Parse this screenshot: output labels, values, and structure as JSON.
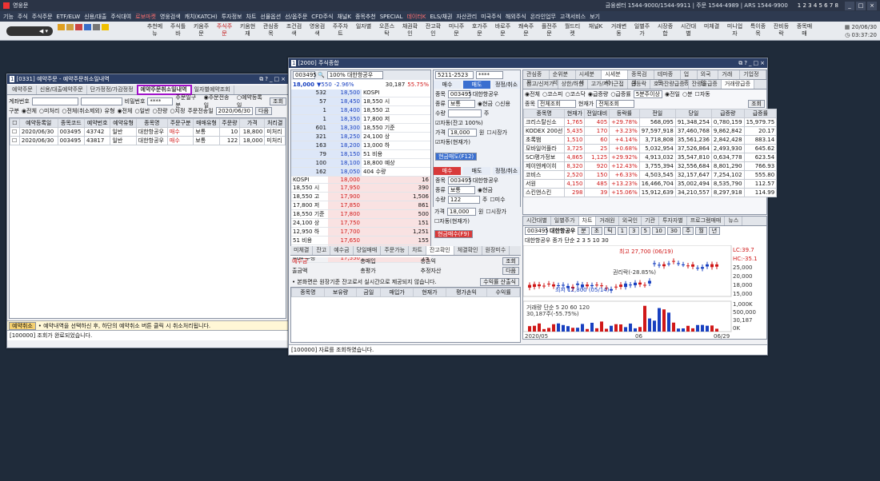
{
  "app": {
    "name": "영웅문",
    "center": "금융센터 1544-9000/1544-9911 | 주문 1544-4989 | ARS 1544-9900",
    "title_numbers": "1 2 3 4 5 6 7 8"
  },
  "menu": [
    "기능",
    "주식",
    "주식주문",
    "ETF/ELW",
    "신용/대출",
    "주식대여",
    "로보마켓",
    "영웅검색",
    "캐치(KATCH)",
    "투자정보",
    "차트",
    "선물옵션",
    "선/옵주문",
    "CFD주식",
    "채널K",
    "종목추천",
    "SPECIAL",
    "데이터K",
    "ELS/채권",
    "자산관리",
    "미국주식",
    "해외주식",
    "온라인업무",
    "고객서비스",
    "보기"
  ],
  "toolbar": {
    "items": [
      "추천메뉴",
      "주식틀바",
      "키움주문",
      "주식주문",
      "키움현재",
      "관심종목",
      "조건검색",
      "영웅검색",
      "주주차트",
      "일자별",
      "오픈스탁",
      "채권확인",
      "잔고확인",
      "미니주문",
      "호가주문",
      "바로주문",
      "쾌속주문",
      "플전주문",
      "월드티켓",
      "채널K",
      "거래변동",
      "일별주가",
      "시장종합",
      "시간대별",
      "미체결",
      "미니업자",
      "특이종목",
      "잔비등락",
      "종목매매"
    ],
    "date": "20/06/30",
    "time": "03:37:20"
  },
  "win1": {
    "title": "[0331] 예약주문 - 예약주문취소일내역",
    "tabs": [
      "예약주문",
      "신용/대출예약주문",
      "단가정정/가감정정",
      "예약주문취소일내역",
      "일자별예약조회"
    ],
    "account_label": "계좌번호",
    "password_label": "비밀번호",
    "password": "****",
    "order_kind_label": "주문일구분",
    "opt1": "주문전송일",
    "opt2": "예약등록일",
    "query": "조회",
    "filter_label": "구분",
    "f1": "전체",
    "f2": "미처리",
    "f3": "전체(취소제외)",
    "type_label": "유형",
    "t1": "전체",
    "t2": "일반",
    "t3": "잔량",
    "t4": "지정",
    "send_label": "주문전송일",
    "send_date": "2020/06/30",
    "next": "다음",
    "cols": [
      "예약등록일",
      "종목코드",
      "예약번호",
      "예약유형",
      "종목명",
      "주문구분",
      "매매유형",
      "주문량",
      "가격",
      "처리결"
    ],
    "rows": [
      [
        "2020/06/30",
        "003495",
        "43742",
        "일반",
        "대한항공우",
        "매수",
        "보통",
        "10",
        "18,800",
        "미처리"
      ],
      [
        "2020/06/30",
        "003495",
        "43817",
        "일반",
        "대한항공우",
        "매수",
        "보통",
        "122",
        "18,000",
        "미처리"
      ]
    ],
    "cancel": "예약취소",
    "notice": "• 예약내역을 선택하신 후, 하단의 예약취소 버튼 클릭 시 취소처리됩니다.",
    "status": "[100000] 조회가 완료되었습니다."
  },
  "win2": {
    "title": "[2000] 주식종합",
    "code": "003495",
    "name": "100% 대한항공우",
    "price": "18,000",
    "change": "550",
    "pct": "-2.96%",
    "volume": "30,187",
    "rate": "55.75%",
    "asks": [
      [
        "532",
        "18,500"
      ],
      [
        "57",
        "18,450"
      ],
      [
        "1",
        "18,400"
      ],
      [
        "1",
        "18,350"
      ],
      [
        "601",
        "18,300"
      ],
      [
        "321",
        "18,250"
      ],
      [
        "163",
        "18,200"
      ],
      [
        "79",
        "18,150"
      ],
      [
        "100",
        "18,100"
      ],
      [
        "162",
        "18,050"
      ]
    ],
    "bids": [
      [
        "18,000",
        "16"
      ],
      [
        "17,950",
        "390"
      ],
      [
        "17,900",
        "1,506"
      ],
      [
        "17,850",
        "861"
      ],
      [
        "17,800",
        "500"
      ],
      [
        "17,750",
        "151"
      ],
      [
        "17,700",
        "1,251"
      ],
      [
        "17,650",
        "155"
      ],
      [
        "17,600",
        "210"
      ],
      [
        "17,550",
        "79"
      ]
    ],
    "info_left": [
      "KOSPI",
      "18,550 시",
      "18,550 고",
      "17,800 저",
      "18,550 기준",
      "24,100 상",
      "12,950 하",
      "51 비용",
      "18,800 예상",
      "404 수량",
      "▼ 550 -2.96%"
    ],
    "info_right": [
      "KOSPI",
      "18,550 시",
      "18,550 고",
      "17,800 저",
      "18,550 기준",
      "24,100 상",
      "13,000 하",
      "51 비용",
      "18,800 예상",
      "404 수량",
      "▼ 550 -2.96%"
    ],
    "bottom": [
      "2,017",
      "16:00:00",
      "55",
      "5,119"
    ],
    "bottom2": [
      "시간외",
      "2"
    ],
    "order": {
      "account": "5211-2523",
      "pw": "****",
      "buy_tab": "매수",
      "sell_tab": "매도",
      "mod_tab": "정정/취소",
      "code_label": "종목",
      "code": "003495",
      "stock": "대한항공우",
      "type_label": "종류",
      "type": "보통",
      "cash": "현금",
      "credit": "신용",
      "qty_label": "수량",
      "price_label": "가격",
      "price": "18,000",
      "auto": "자동(잔고 100%)",
      "market": "시장가",
      "auto2": "자동(현재가)",
      "sell_btn": "현금매도(F12)",
      "buy_btn": "현금매수(F9)",
      "qty": "122",
      "unit": "원",
      "amount": "주",
      "mid": "미수"
    },
    "tabs": [
      "미체결",
      "잔고",
      "예수금",
      "당일매매",
      "주문가능",
      "차트",
      "잔고확인",
      "체결확인",
      "원장미수"
    ],
    "bal": {
      "cash_label": "예수금",
      "loan_label": "출금액",
      "total_buy": "총매입",
      "total_eval": "총평가",
      "total_pl": "총손익",
      "profit": "추정자산",
      "q": "조회",
      "next": "다음",
      "notice": "• 본화면은 원장기준 잔고로서 실시간으로 제공되지 않습니다.",
      "calc": "수익률 산출식"
    },
    "bal_cols": [
      "종목명",
      "보유량",
      "금일",
      "매입가",
      "현재가",
      "평가손익",
      "수익률"
    ],
    "status": "[100000] 자료를 조회하였습니다."
  },
  "right": {
    "top_tabs": [
      "시세분석",
      "종목검색",
      "테마종목",
      "업종",
      "외국인",
      "거래원",
      "기업정보"
    ],
    "tabs2": [
      "관심종목",
      "순위분석",
      "시세분석"
    ],
    "sub_tabs": [
      "신고/신저가",
      "상한/하한",
      "고가/저가근접",
      "급등락",
      "호가잔량급증",
      "잔량율급증",
      "거래량급증"
    ],
    "radios": [
      "전체",
      "코스피",
      "코스닥"
    ],
    "radios2": [
      "급증량",
      "급증률"
    ],
    "period": "5분주이상",
    "opt": [
      "전일",
      "분"
    ],
    "auto": "자동",
    "col_label": "종목",
    "col_val": "전체조회",
    "col2_label": "현재가",
    "col2_val": "전체조회",
    "query": "조회",
    "cols": [
      "종목명",
      "현재가",
      "전일대비",
      "등락률",
      "전일",
      "당일",
      "급증량",
      "급증률"
    ],
    "rows": [
      [
        "크리스탈신소",
        "1,765",
        "405",
        "+29.78%",
        "568,095",
        "91,348,254",
        "0,780,159",
        "15,979.75"
      ],
      [
        "KODEX 200선",
        "5,435",
        "170",
        "+3.23%",
        "97,597,918",
        "37,460,768",
        "9,862,842",
        "20.17"
      ],
      [
        "초록뱀",
        "1,510",
        "60",
        "+4.14%",
        "3,718,808",
        "35,561,236",
        "2,842,428",
        "883.14"
      ],
      [
        "모바일어플라",
        "3,725",
        "25",
        "+0.68%",
        "5,032,954",
        "37,526,864",
        "2,493,930",
        "645.62"
      ],
      [
        "SCI평가정보",
        "4,865",
        "1,125",
        "+29.92%",
        "4,913,032",
        "35,547,810",
        "0,634,778",
        "623.54"
      ],
      [
        "제이엔케이히",
        "8,320",
        "920",
        "+12.43%",
        "3,755,394",
        "32,556,684",
        "8,801,290",
        "766.93"
      ],
      [
        "코비스",
        "2,520",
        "150",
        "+6.33%",
        "4,503,545",
        "32,157,647",
        "7,254,102",
        "555.80"
      ],
      [
        "서원",
        "4,150",
        "485",
        "+13.23%",
        "16,466,704",
        "35,002,494",
        "8,535,790",
        "112.57"
      ],
      [
        "스킨앤스킨",
        "298",
        "39",
        "+15.06%",
        "15,912,639",
        "34,210,557",
        "8,297,918",
        "114.99"
      ]
    ],
    "chart_tabs": [
      "시간대별",
      "일별주가",
      "차트",
      "거래원",
      "외국인",
      "기관",
      "투자자별",
      "프로그램매매",
      "뉴스"
    ],
    "chart": {
      "code": "003495",
      "name": "대한항공우",
      "periods": [
        "분",
        "초",
        "틱",
        "1",
        "3",
        "5",
        "10",
        "30",
        "주",
        "월",
        "년"
      ],
      "legend": "대한항공우 종가 단순 2 3 5 10 30",
      "max_label": "최고 27,700 (06/19)",
      "low_label": "최저 12,800 (05/14)",
      "ex_label": "권리락(-28.85%)",
      "scale": [
        "LC:39.7",
        "HC:-35.1",
        "25,000",
        "20,000",
        "18,000",
        "15,000"
      ],
      "vol_legend": "거래량 단순 5 20 60 120",
      "vol_label": "30,187주(-55.75%)",
      "vol_scale": [
        "1,000K",
        "500,000",
        "30,187",
        "0K"
      ],
      "x_labels": [
        "2020/05",
        "06",
        "06/29"
      ]
    }
  }
}
